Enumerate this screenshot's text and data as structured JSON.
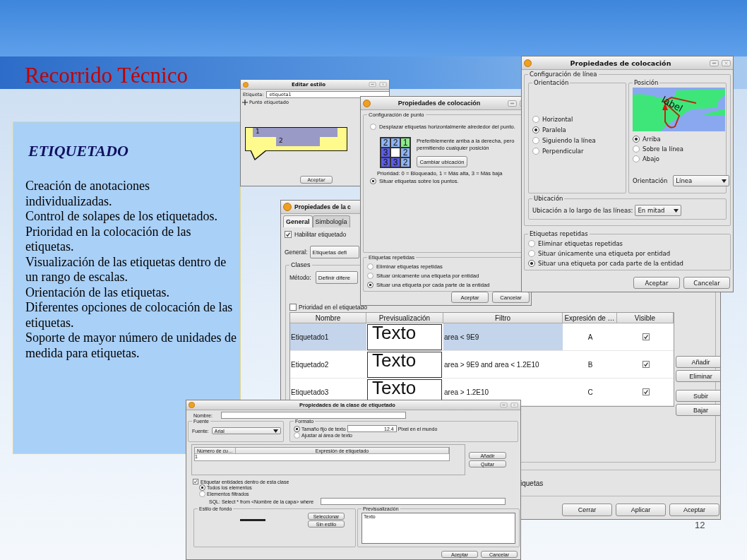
{
  "slide": {
    "title": "Recorrido Técnico",
    "page_number": "12"
  },
  "content": {
    "heading": "ETIQUETADO",
    "items": [
      "Creación de anotaciones individualizadas.",
      "Control de solapes de los etiquetados.",
      "Prioridad en la colocación de las etiquetas.",
      "Visualización de las etiquetas dentro de un rango de escalas.",
      "Orientación de las etiquetas.",
      "Diferentes opciones de colocación de las etiquetas.",
      "Soporte de mayor número de unidades de medida para etiquetas."
    ]
  },
  "style_editor": {
    "title": "Editar estilo",
    "label_field": {
      "label": "Etiqueta:",
      "value": "etiqueta1"
    },
    "point_label": "Punto etiquetado",
    "balloon_labels": [
      "1",
      "2"
    ],
    "buttons": [
      "Aceptar"
    ]
  },
  "point_placement": {
    "title": "Propiedades de colocación",
    "section": "Configuración de punto",
    "placement_options": [
      {
        "label": "Desplazar etiquetas horizontalmente alrededor del punto.",
        "selected": false
      },
      {
        "label": "Situar etiquetas sobre los puntos.",
        "selected": true
      }
    ],
    "priority_grid": [
      [
        {
          "value": "2",
          "color": "#8fb4f4"
        },
        {
          "value": "2",
          "color": "#8fb4f4"
        },
        {
          "value": "1",
          "color": "#8cec8c"
        }
      ],
      [
        {
          "value": "3",
          "color": "#5c5ce6"
        },
        {
          "color": "#ffffff"
        },
        {
          "value": "2",
          "color": "#8fb4f4"
        }
      ],
      [
        {
          "value": "3",
          "color": "#5c5ce6"
        },
        {
          "value": "3",
          "color": "#5c5ce6"
        },
        {
          "value": "2",
          "color": "#8fb4f4"
        }
      ]
    ],
    "description": "Preferiblemente arriba a la derecha, pero permitiendo cualquier posición",
    "change_button": "Cambiar ubicación",
    "priority_note": "Prioridad: 0 = Bloqueado, 1 = Más alta, 3 = Más baja",
    "repeated": {
      "title": "Etiquetas repetidas",
      "options": [
        {
          "label": "Eliminar etiquetas repetidas",
          "selected": false
        },
        {
          "label": "Situar únicamente una etiqueta por entidad",
          "selected": false
        },
        {
          "label": "Situar una etiqueta por cada parte de la entidad",
          "selected": true
        }
      ]
    },
    "buttons": [
      "Aceptar",
      "Cancelar"
    ]
  },
  "line_placement": {
    "title": "Propiedades de colocación",
    "section": "Configuración de línea",
    "orientation": {
      "title": "Orientación",
      "options": [
        {
          "label": "Horizontal",
          "selected": false
        },
        {
          "label": "Paralela",
          "selected": true
        },
        {
          "label": "Siguiendo la línea",
          "selected": false
        },
        {
          "label": "Perpendicular",
          "selected": false
        }
      ]
    },
    "position": {
      "title": "Posición",
      "preview_label": "label",
      "options": [
        {
          "label": "Arriba",
          "selected": true
        },
        {
          "label": "Sobre la línea",
          "selected": false
        },
        {
          "label": "Abajo",
          "selected": false
        }
      ],
      "orientation_label": "Orientación",
      "orientation_value": "Línea"
    },
    "location": {
      "title": "Ubicación",
      "label": "Ubicación a lo largo de las líneas:",
      "value": "En mitad"
    },
    "repeated": {
      "title": "Etiquetas repetidas",
      "options": [
        {
          "label": "Eliminar etiquetas repetidas",
          "selected": false
        },
        {
          "label": "Situar únicamente una etiqueta por entidad",
          "selected": false
        },
        {
          "label": "Situar una etiqueta por cada parte de la entidad",
          "selected": true
        }
      ]
    },
    "buttons": [
      "Aceptar",
      "Cancelar"
    ]
  },
  "main_dialog": {
    "title": "Propiedades de la c",
    "tabs": [
      {
        "label": "General",
        "selected": true
      },
      {
        "label": "Simbología",
        "selected": false
      }
    ],
    "enable_labeling": {
      "label": "Habilitar etiquetado",
      "checked": true
    },
    "general": {
      "label": "General:",
      "value": "Etiquetas defi"
    },
    "classes": {
      "title": "Clases",
      "method_label": "Método:",
      "method_value": "Definir difere",
      "priority": {
        "label": "Prioridad en el etiquetado",
        "checked": false
      },
      "table": {
        "columns": [
          "Nombre",
          "Previsualización",
          "Filtro",
          "Expresión de …",
          "Visible"
        ],
        "rows": [
          {
            "name": "Etiquetado1",
            "preview": "Texto",
            "filter": "area < 9E9",
            "expression": "A",
            "visible": true,
            "selected": true
          },
          {
            "name": "Etiquetado2",
            "preview": "Texto",
            "filter": "area > 9E9 and area < 1.2E10",
            "expression": "B",
            "visible": true,
            "selected": false
          },
          {
            "name": "Etiquetado3",
            "preview": "Texto",
            "filter": "area > 1.2E10",
            "expression": "C",
            "visible": true,
            "selected": false
          }
        ]
      },
      "side_buttons": [
        "Añadir",
        "Eliminar",
        "Subir",
        "Bajar"
      ]
    },
    "partial_text": "iquetas",
    "buttons": [
      "Cerrar",
      "Aplicar",
      "Aceptar"
    ]
  },
  "class_dialog": {
    "title": "Propiedades de la clase de etiquetado",
    "name_label": "Nombre:",
    "font": {
      "title": "Fuente",
      "label": "Fuente:",
      "value": "Arial"
    },
    "format": {
      "title": "Formato",
      "options": [
        {
          "label": "Tamaño fijo de texto",
          "selected": true
        },
        {
          "label": "Ajustar al área de texto",
          "selected": false
        }
      ],
      "size": "12.4",
      "unit": "Pixel en el mundo"
    },
    "expressions": {
      "columns": [
        "Número de cu…",
        "Expresión de etiquetado"
      ],
      "rows": [
        {
          "number": "1"
        }
      ]
    },
    "expression_buttons": [
      "Añadir",
      "Quitar"
    ],
    "filter": {
      "label": "Etiquetar entidades dentro de esta clase",
      "checked": true,
      "options": [
        {
          "label": "Todos los elementos",
          "selected": true
        },
        {
          "label": "Elementos filtrados",
          "selected": false
        }
      ],
      "sql": "SQL: Select * from <Nombre de la capa> where"
    },
    "background": {
      "title": "Estilo de fondo",
      "buttons": [
        "Seleccionar",
        "Sin estilo"
      ]
    },
    "preview": {
      "title": "Previsualización",
      "text": "Texto"
    },
    "buttons": [
      "Aceptar",
      "Cancelar"
    ]
  }
}
